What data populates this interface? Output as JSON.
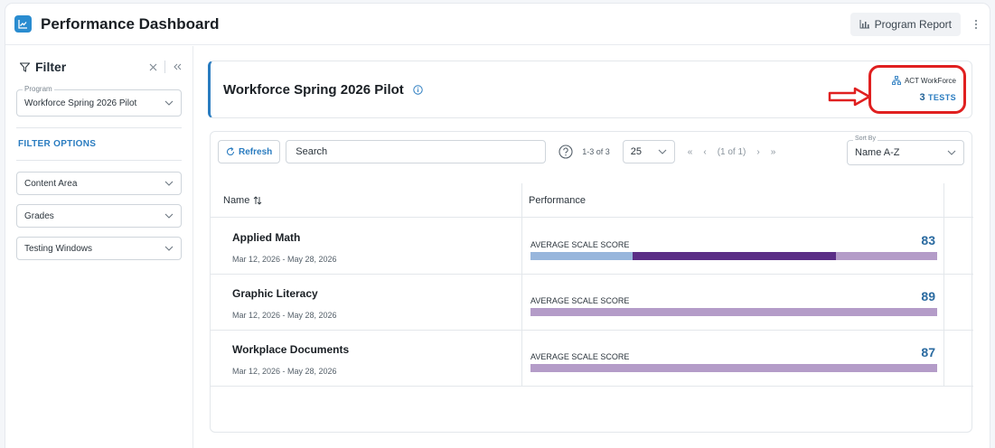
{
  "header": {
    "title": "Performance Dashboard",
    "report_button": "Program Report"
  },
  "sidebar": {
    "title": "Filter",
    "program_label": "Program",
    "program_value": "Workforce Spring 2026 Pilot",
    "filter_options_label": "FILTER OPTIONS",
    "dropdowns": [
      "Content Area",
      "Grades",
      "Testing Windows"
    ]
  },
  "program_card": {
    "name": "Workforce Spring 2026 Pilot",
    "assessment": "ACT WorkForce",
    "tests_count": "3",
    "tests_label": "TESTS"
  },
  "toolbar": {
    "refresh_label": "Refresh",
    "search_value": "Search",
    "range_text": "1-3 of 3",
    "per_page": "25",
    "page_text": "(1 of 1)",
    "sort_label": "Sort By",
    "sort_value": "Name A-Z"
  },
  "table": {
    "columns": [
      "Name",
      "Performance"
    ],
    "rows": [
      {
        "name": "Applied Math",
        "dates": "Mar 12, 2026 - May 28, 2026",
        "metric_label": "AVERAGE SCALE SCORE",
        "score": "83",
        "bar_segments": [
          0.25,
          0.5,
          0.25
        ]
      },
      {
        "name": "Graphic Literacy",
        "dates": "Mar 12, 2026 - May 28, 2026",
        "metric_label": "AVERAGE SCALE SCORE",
        "score": "89",
        "bar_segments": [
          0,
          0,
          1
        ]
      },
      {
        "name": "Workplace Documents",
        "dates": "Mar 12, 2026 - May 28, 2026",
        "metric_label": "AVERAGE SCALE SCORE",
        "score": "87",
        "bar_segments": [
          0,
          0,
          1
        ]
      }
    ]
  },
  "colors": {
    "accent": "#2a7cc0",
    "highlight_outline": "#e02020",
    "bar_light_blue": "#98b6dc",
    "bar_dark_purple": "#5b2e86",
    "bar_light_purple": "#b49cc8"
  },
  "icons": [
    "chart-icon",
    "bar-chart-icon",
    "kebab-icon",
    "filter-icon",
    "close-icon",
    "collapse-icon",
    "chevron-down-icon",
    "info-icon",
    "hierarchy-icon",
    "refresh-icon",
    "help-icon",
    "first-page-icon",
    "prev-page-icon",
    "next-page-icon",
    "last-page-icon",
    "sort-icon",
    "arrow-annotation"
  ]
}
